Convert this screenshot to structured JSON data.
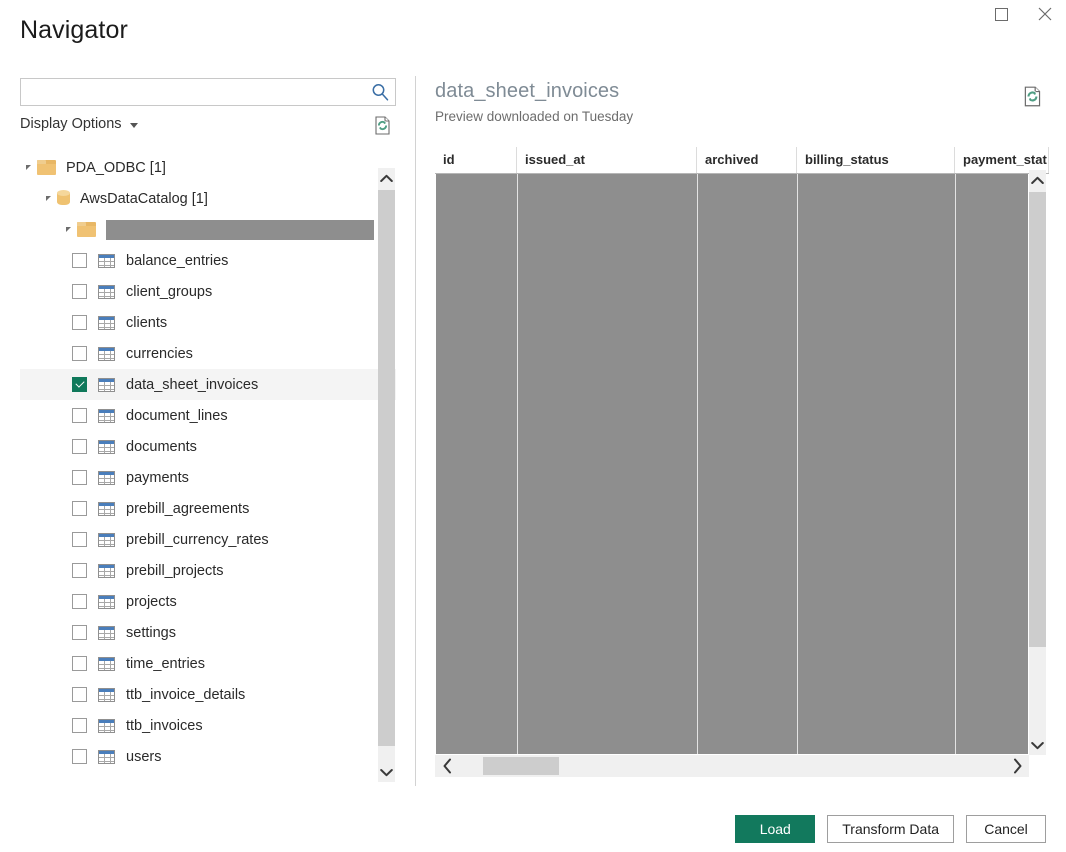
{
  "window": {
    "title": "Navigator",
    "controls": [
      {
        "name": "maximize-button",
        "icon": "square-icon",
        "label": ""
      },
      {
        "name": "close-button",
        "icon": "close-icon",
        "label": "✕"
      }
    ]
  },
  "search": {
    "value": "",
    "placeholder": "",
    "icon": "search-icon"
  },
  "display_options": {
    "label": "Display Options",
    "caret": "chevron-down-icon",
    "refresh_icon": "refresh-preview-icon"
  },
  "tree": {
    "nodes": [
      {
        "type": "folder",
        "label": "PDA_ODBC [1]",
        "indent": 0,
        "expanded": true,
        "icon": "folder-icon"
      },
      {
        "type": "database",
        "label": "AwsDataCatalog [1]",
        "indent": 1,
        "expanded": true,
        "icon": "database-icon"
      },
      {
        "type": "folder-redacted",
        "label": "",
        "indent": 2,
        "expanded": true,
        "icon": "folder-icon"
      }
    ],
    "tables": [
      {
        "label": "balance_entries",
        "checked": false,
        "selected": false
      },
      {
        "label": "client_groups",
        "checked": false,
        "selected": false
      },
      {
        "label": "clients",
        "checked": false,
        "selected": false
      },
      {
        "label": "currencies",
        "checked": false,
        "selected": false
      },
      {
        "label": "data_sheet_invoices",
        "checked": true,
        "selected": true
      },
      {
        "label": "document_lines",
        "checked": false,
        "selected": false
      },
      {
        "label": "documents",
        "checked": false,
        "selected": false
      },
      {
        "label": "payments",
        "checked": false,
        "selected": false
      },
      {
        "label": "prebill_agreements",
        "checked": false,
        "selected": false
      },
      {
        "label": "prebill_currency_rates",
        "checked": false,
        "selected": false
      },
      {
        "label": "prebill_projects",
        "checked": false,
        "selected": false
      },
      {
        "label": "projects",
        "checked": false,
        "selected": false
      },
      {
        "label": "settings",
        "checked": false,
        "selected": false
      },
      {
        "label": "time_entries",
        "checked": false,
        "selected": false
      },
      {
        "label": "ttb_invoice_details",
        "checked": false,
        "selected": false
      },
      {
        "label": "ttb_invoices",
        "checked": false,
        "selected": false
      },
      {
        "label": "users",
        "checked": false,
        "selected": false
      }
    ]
  },
  "preview": {
    "title": "data_sheet_invoices",
    "subtitle": "Preview downloaded on Tuesday",
    "refresh_icon": "refresh-preview-icon",
    "columns": [
      {
        "label": "id",
        "width": 82
      },
      {
        "label": "issued_at",
        "width": 180
      },
      {
        "label": "archived",
        "width": 100
      },
      {
        "label": "billing_status",
        "width": 158
      },
      {
        "label": "payment_stat",
        "width": 94
      }
    ]
  },
  "scrollbars": {
    "tree_up_icon": "chevron-up-icon",
    "tree_down_icon": "chevron-down-icon",
    "preview_up_icon": "chevron-up-icon",
    "preview_down_icon": "chevron-down-icon",
    "hscroll_left_icon": "chevron-left-icon",
    "hscroll_right_icon": "chevron-right-icon"
  },
  "footer": {
    "buttons": [
      {
        "name": "load-button",
        "label": "Load",
        "style": "primary"
      },
      {
        "name": "transform-data-button",
        "label": "Transform Data",
        "style": "default"
      },
      {
        "name": "cancel-button",
        "label": "Cancel",
        "style": "default"
      }
    ]
  },
  "colors": {
    "accent_green": "#12795d",
    "folder_orange": "#f0c273",
    "redacted_gray": "#8e8e8e",
    "title_gray": "#7f8b95"
  }
}
